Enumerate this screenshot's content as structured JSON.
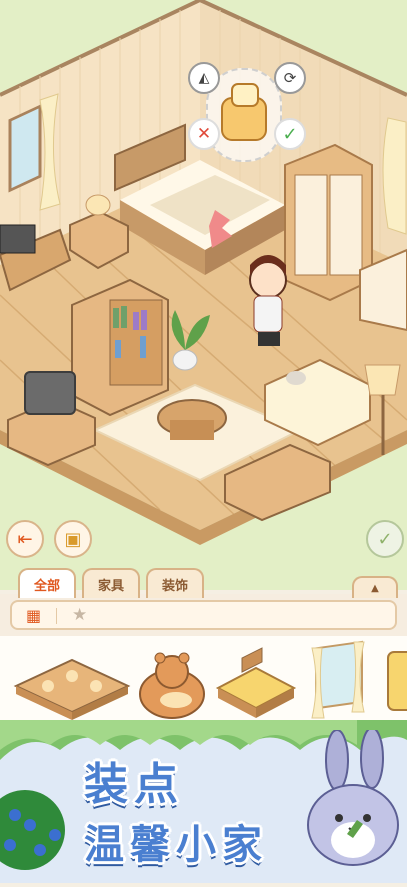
{
  "tabs": [
    {
      "label": "全部",
      "active": true
    },
    {
      "label": "家具",
      "active": false
    },
    {
      "label": "装饰",
      "active": false
    }
  ],
  "banner": {
    "line1": "装点",
    "line2": "温馨小家"
  },
  "icons": {
    "exit": "exit-icon",
    "store": "storage-box-icon",
    "confirm": "check-icon",
    "grid": "grid-icon",
    "favorite": "star-icon",
    "rotate": "rotate-icon",
    "flip": "flip-icon",
    "cancel": "close-icon",
    "place": "check-icon"
  },
  "colors": {
    "accent": "#e0581f",
    "confirm_green": "#4caf50",
    "cancel_red": "#e04a3a",
    "title_blue": "#4a7fd0"
  },
  "items": [
    {
      "name": "corner-sofa"
    },
    {
      "name": "bear-cushion"
    },
    {
      "name": "wooden-bed"
    },
    {
      "name": "curtain-window"
    },
    {
      "name": "partial-item"
    }
  ]
}
